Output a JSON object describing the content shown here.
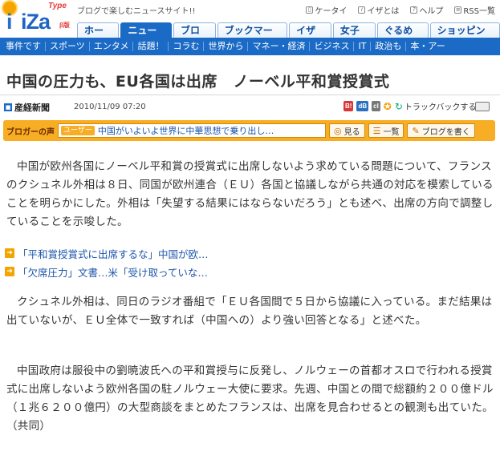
{
  "header": {
    "logo_text": "iZa",
    "logo_tiny": "Type",
    "logo_beta": "β版",
    "tagline": "ブログで楽しむニュースサイト!!",
    "toplinks": [
      {
        "label": "ケータイ",
        "icon": "mobile-icon"
      },
      {
        "label": "イザとは",
        "icon": "info-icon"
      },
      {
        "label": "ヘルプ",
        "icon": "help-icon"
      },
      {
        "label": "RSS一覧",
        "icon": "rss-icon"
      }
    ],
    "tabs": [
      "ホーム",
      "ニュース",
      "ブログ",
      "ブックマーク",
      "イザ語",
      "女子部",
      "ぐるめ部",
      "ショッピング"
    ],
    "active_tab": "ニュース"
  },
  "subnav": [
    "事件です",
    "スポーツ",
    "エンタメ",
    "話題！",
    "コラむ",
    "世界から",
    "マネー・経済",
    "ビジネス",
    "IT",
    "政治も",
    "本・アー"
  ],
  "article": {
    "title": "中国の圧力も、EU各国は出席　ノーベル平和賞授賞式",
    "source": "産経新聞",
    "date": "2010/11/09 07:20",
    "trackback": "トラックバックする",
    "paragraph1": "中国が欧州各国にノーベル平和賞の授賞式に出席しないよう求めている問題について、フランスのクシュネル外相は８日、同国が欧州連合（ＥＵ）各国と協議しながら共通の対応を模索していることを明らかにした。外相は「失望する結果にはならないだろう」とも述べ、出席の方向で調整していることを示唆した。",
    "paragraph2": "クシュネル外相は、同日のラジオ番組で「ＥＵ各国間で５日から協議に入っている。まだ結果は出ていないが、ＥＵ全体で一致すれば（中国への）より強い回答となる」と述べた。",
    "paragraph3": "中国政府は服役中の劉暁波氏への平和賞授与に反発し、ノルウェーの首都オスロで行われる授賞式に出席しないよう欧州各国の駐ノルウェー大使に要求。先週、中国との間で総額約２００億ドル（１兆６２００億円）の大型商談をまとめたフランスは、出席を見合わせるとの観測も出ていた。（共同）"
  },
  "blogbar": {
    "label": "ブロガーの声",
    "user_badge": "ユーザー",
    "link": "中国がいよいよ世界に中華思想で乗り出し…",
    "view": "見る",
    "list": "一覧",
    "write": "ブログを書く"
  },
  "related": [
    "「平和賞授賞式に出席するな」中国が欧…",
    "「欠席圧力」文書…米「受け取っていな…"
  ],
  "colors": {
    "brand_blue": "#1b6bc6",
    "blogbar_orange": "#f7ad24",
    "link_blue": "#1b55aa"
  }
}
